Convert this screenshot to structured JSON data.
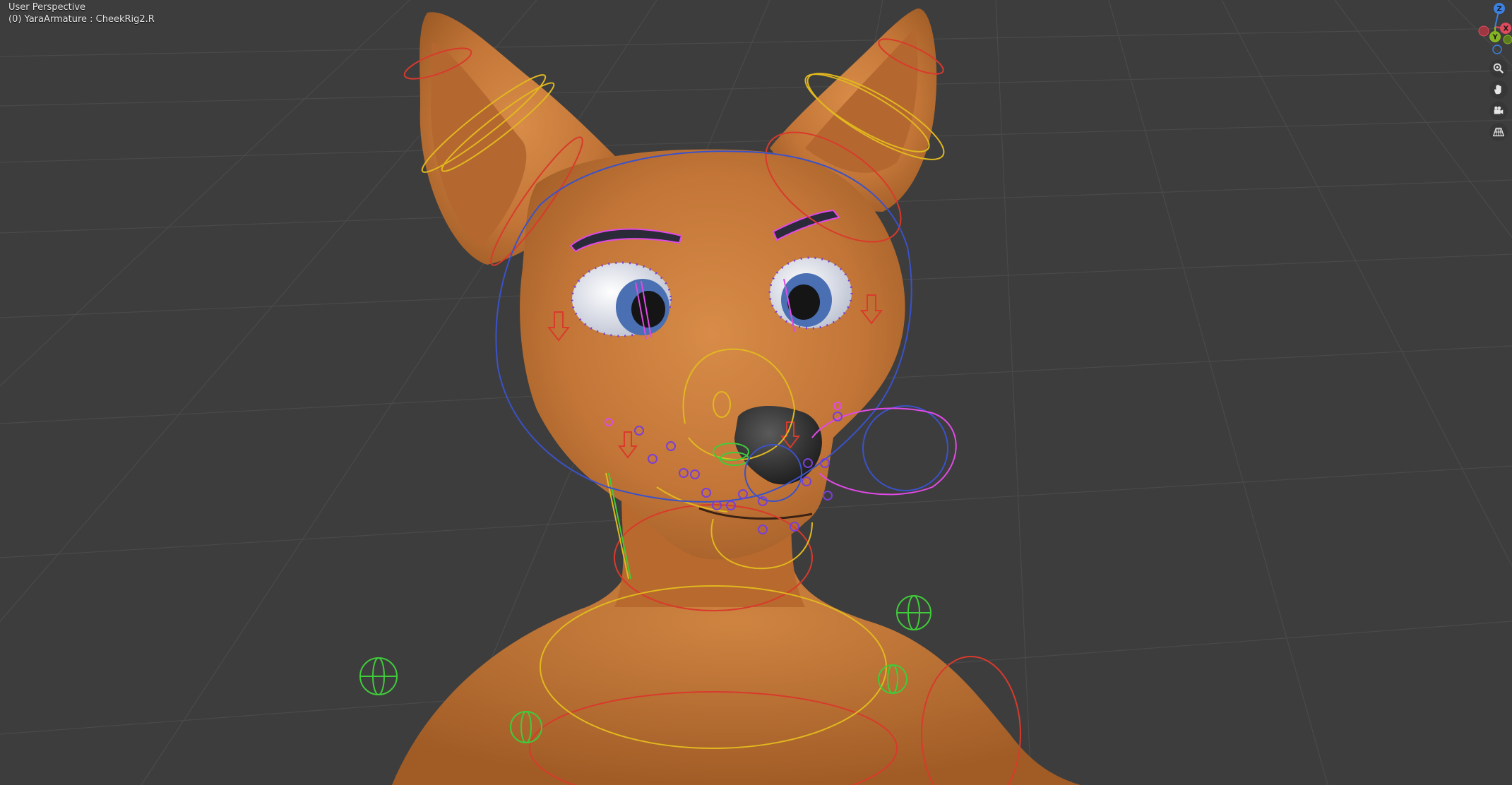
{
  "viewport": {
    "view_name": "User Perspective",
    "active_object": "(0) YaraArmature : CheekRig2.R"
  },
  "gizmo": {
    "axes": {
      "x": "X",
      "y": "Y",
      "z": "Z"
    },
    "colors": {
      "x": "#e04a5c",
      "y": "#86b523",
      "z": "#3c80e0"
    }
  },
  "nav_tools": [
    {
      "name": "zoom-icon"
    },
    {
      "name": "pan-hand-icon"
    },
    {
      "name": "camera-view-icon"
    },
    {
      "name": "perspective-toggle-icon"
    }
  ],
  "colors": {
    "background": "#3d3d3d",
    "grid": "#4d4d4d",
    "skin": "#c97c3c",
    "rig_red": "#d83a2c",
    "rig_yellow": "#e1b81f",
    "rig_green": "#3fcc3a",
    "rig_blue": "#3b52c9",
    "rig_magenta": "#e04ae6",
    "rig_purple": "#7a3fd6"
  }
}
